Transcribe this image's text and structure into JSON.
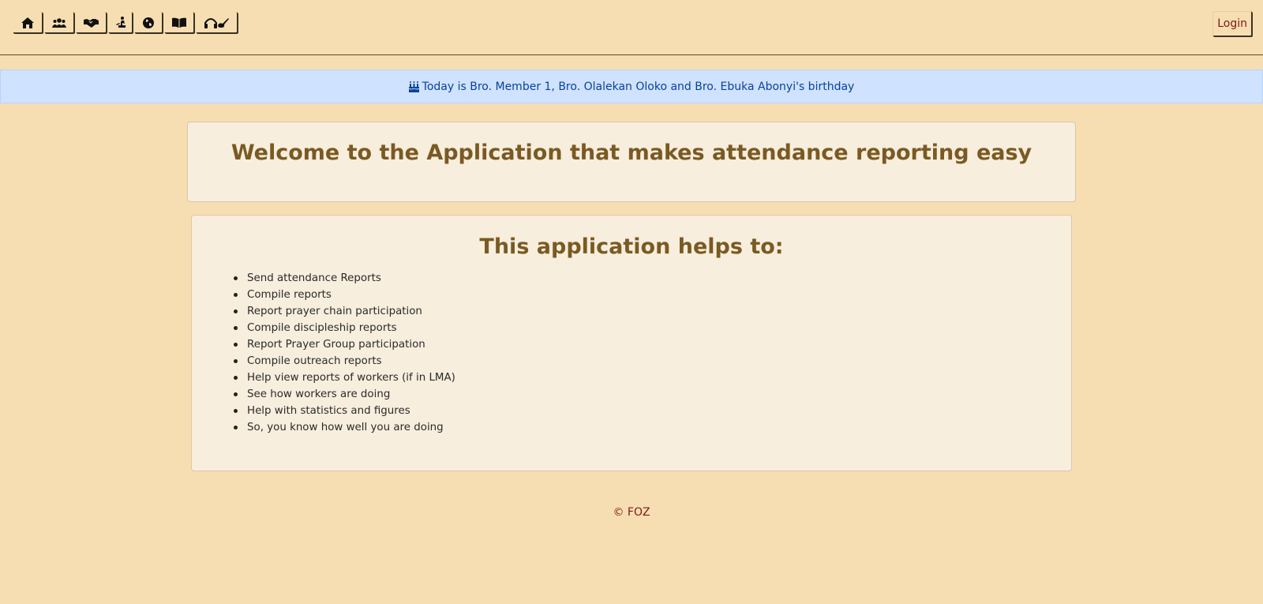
{
  "nav": {
    "items": [
      {
        "name": "home-icon"
      },
      {
        "name": "users-icon"
      },
      {
        "name": "handshake-icon"
      },
      {
        "name": "praying-icon"
      },
      {
        "name": "globe-icon"
      },
      {
        "name": "book-icon"
      },
      {
        "name": "headphones-guitar-icon"
      }
    ],
    "login_label": "Login"
  },
  "banner": {
    "icon": "birthday-cake-icon",
    "text": "Today is Bro. Member 1, Bro. Olalekan Oloko and Bro. Ebuka Abonyi's birthday"
  },
  "welcome": {
    "title": "Welcome to the Application that makes attendance reporting easy"
  },
  "helps": {
    "title": "This application helps to:",
    "items": [
      "Send attendance Reports",
      "Compile reports",
      "Report prayer chain participation",
      "Compile discipleship reports",
      "Report Prayer Group participation",
      "Compile outreach reports",
      "Help view reports of workers (if in LMA)",
      "See how workers are doing",
      "Help with statistics and figures",
      "So, you know how well you are doing"
    ]
  },
  "footer": {
    "text": "© FOZ"
  },
  "colors": {
    "background": "#f6deb2",
    "card": "#f8eedd",
    "heading": "#7a5a23",
    "banner_bg": "#cfe2ff",
    "banner_text": "#084298",
    "link": "#7a1a1a"
  }
}
